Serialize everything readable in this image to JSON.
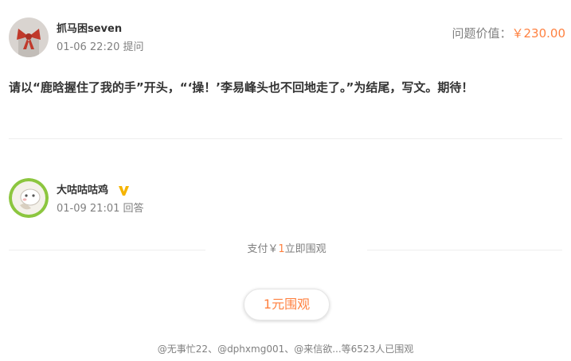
{
  "question": {
    "asker": {
      "name": "抓马困seven",
      "avatar_icon": "avatar-bow-icon",
      "date": "01-06 22:20",
      "action": "提问"
    },
    "price_label": "问题价值：",
    "price_value": "￥230.00",
    "text": "请以“鹿晗握住了我的手”开头，“‘操！’李易峰头也不回地走了。”为结尾，写文。期待！"
  },
  "answer": {
    "answerer": {
      "name": "大咕咕咕鸡",
      "avatar_icon": "avatar-cartoon-icon",
      "verified_icon": "verified-v-icon",
      "date": "01-09 21:01",
      "action": "回答"
    },
    "pay": {
      "prefix": "支付￥",
      "amount": "1",
      "suffix": "立即围观"
    },
    "watch_button_label": "1元围观",
    "watchers_text": "@无事忙22、@dphxmg001、@来信欲...等6523人已围观"
  },
  "colors": {
    "accent": "#ff8140",
    "text_primary": "#333333",
    "text_secondary": "#808080",
    "divider": "#eeeeee",
    "verified": "#f5b400"
  }
}
